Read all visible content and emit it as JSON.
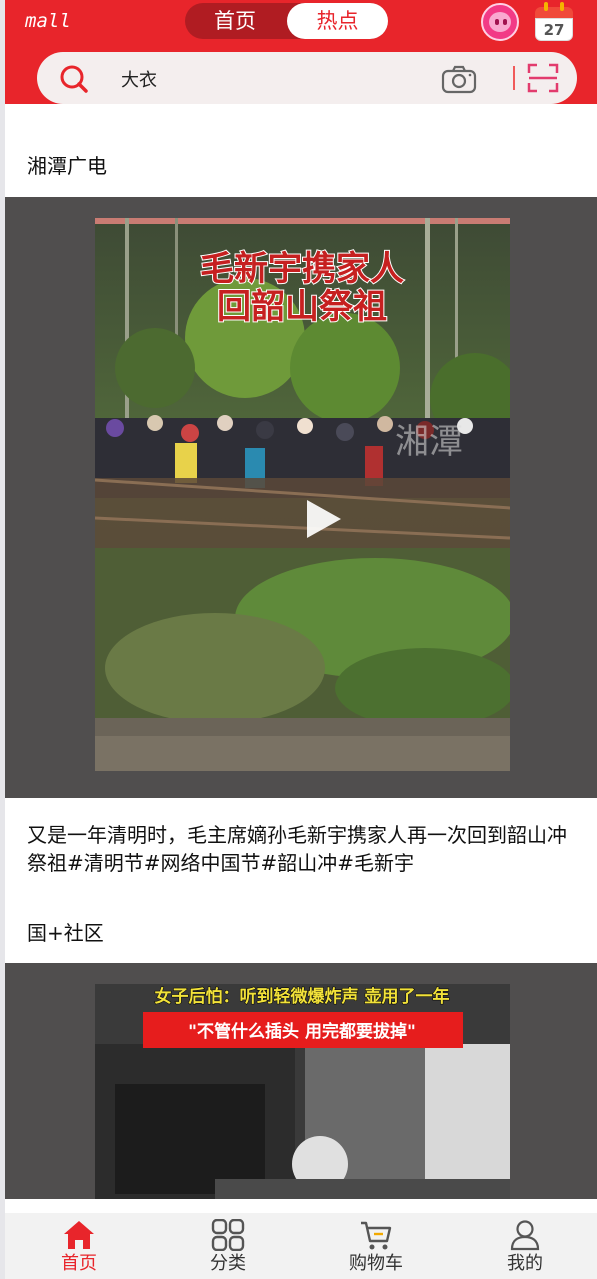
{
  "header": {
    "brand": "mall",
    "tabs": [
      {
        "label": "首页",
        "active": false
      },
      {
        "label": "热点",
        "active": true
      }
    ],
    "calendar_day": "27"
  },
  "search": {
    "value": "大衣"
  },
  "feed": [
    {
      "source": "湘潭广电",
      "thumbnail_title_line1": "毛新宇携家人",
      "thumbnail_title_line2": "回韶山祭祖",
      "thumbnail_watermark": "湘潭",
      "caption": "又是一年清明时，毛主席嫡孙毛新宇携家人再一次回到韶山冲祭祖#清明节#网络中国节#韶山冲#毛新宇"
    },
    {
      "source": "国+社区",
      "thumbnail_title_line1": "女子后怕：听到轻微爆炸声 壶用了一年",
      "thumbnail_title_line2": "\"不管什么插头 用完都要拔掉\""
    }
  ],
  "bottom_nav": [
    {
      "label": "首页",
      "icon": "home-icon",
      "active": true
    },
    {
      "label": "分类",
      "icon": "category-grid-icon",
      "active": false
    },
    {
      "label": "购物车",
      "icon": "cart-icon",
      "active": false
    },
    {
      "label": "我的",
      "icon": "user-icon",
      "active": false
    }
  ],
  "colors": {
    "brand_red": "#e8252b",
    "video_bg": "#504e4e",
    "nav_bg": "#f2f2f2"
  }
}
